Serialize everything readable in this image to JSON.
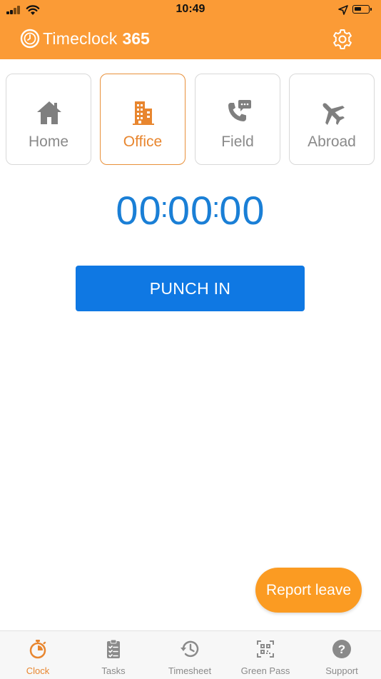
{
  "status_bar": {
    "time": "10:49"
  },
  "header": {
    "app_name": "Timeclock",
    "app_number": "365"
  },
  "modes": [
    {
      "label": "Home",
      "icon": "house-icon",
      "active": false
    },
    {
      "label": "Office",
      "icon": "building-icon",
      "active": true
    },
    {
      "label": "Field",
      "icon": "phone-chat-icon",
      "active": false
    },
    {
      "label": "Abroad",
      "icon": "airplane-icon",
      "active": false
    }
  ],
  "timer": {
    "hours": "00",
    "minutes": "00",
    "seconds": "00"
  },
  "punch_button": {
    "label": "PUNCH IN"
  },
  "report_button": {
    "label": "Report leave"
  },
  "tabs": [
    {
      "label": "Clock",
      "icon": "stopwatch-icon",
      "active": true
    },
    {
      "label": "Tasks",
      "icon": "clipboard-icon",
      "active": false
    },
    {
      "label": "Timesheet",
      "icon": "history-icon",
      "active": false
    },
    {
      "label": "Green Pass",
      "icon": "qr-code-icon",
      "active": false
    },
    {
      "label": "Support",
      "icon": "help-icon",
      "active": false
    }
  ],
  "colors": {
    "brand_orange": "#fb9b36",
    "active_orange": "#e8862f",
    "timer_blue": "#1a7fd6",
    "button_blue": "#0f78e3",
    "inactive_gray": "#8a8a8a"
  }
}
